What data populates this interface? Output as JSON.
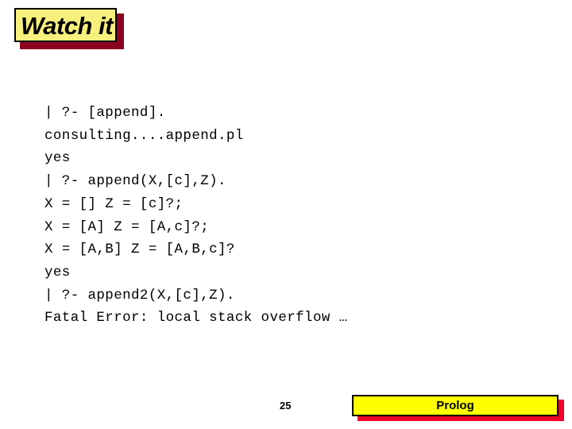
{
  "slide": {
    "background_color": "#ffffff",
    "title": {
      "text": "Watch it",
      "box_color": "#f7f07c",
      "shadow_color": "#8c0020",
      "border_color": "#000000"
    },
    "console": {
      "lines": [
        "| ?- [append].",
        "consulting....append.pl",
        "yes",
        "| ?- append(X,[c],Z).",
        "X = [] Z = [c]?;",
        "X = [A] Z = [A,c]?;",
        "X = [A,B] Z = [A,B,c]?",
        "yes",
        "| ?- append2(X,[c],Z).",
        "Fatal Error: local stack overflow …"
      ],
      "text_color": "#000000"
    },
    "footer": {
      "page_number": "25",
      "label": "Prolog",
      "box_color": "#ffff00",
      "shadow_color": "#f40028",
      "border_color": "#000000"
    }
  }
}
